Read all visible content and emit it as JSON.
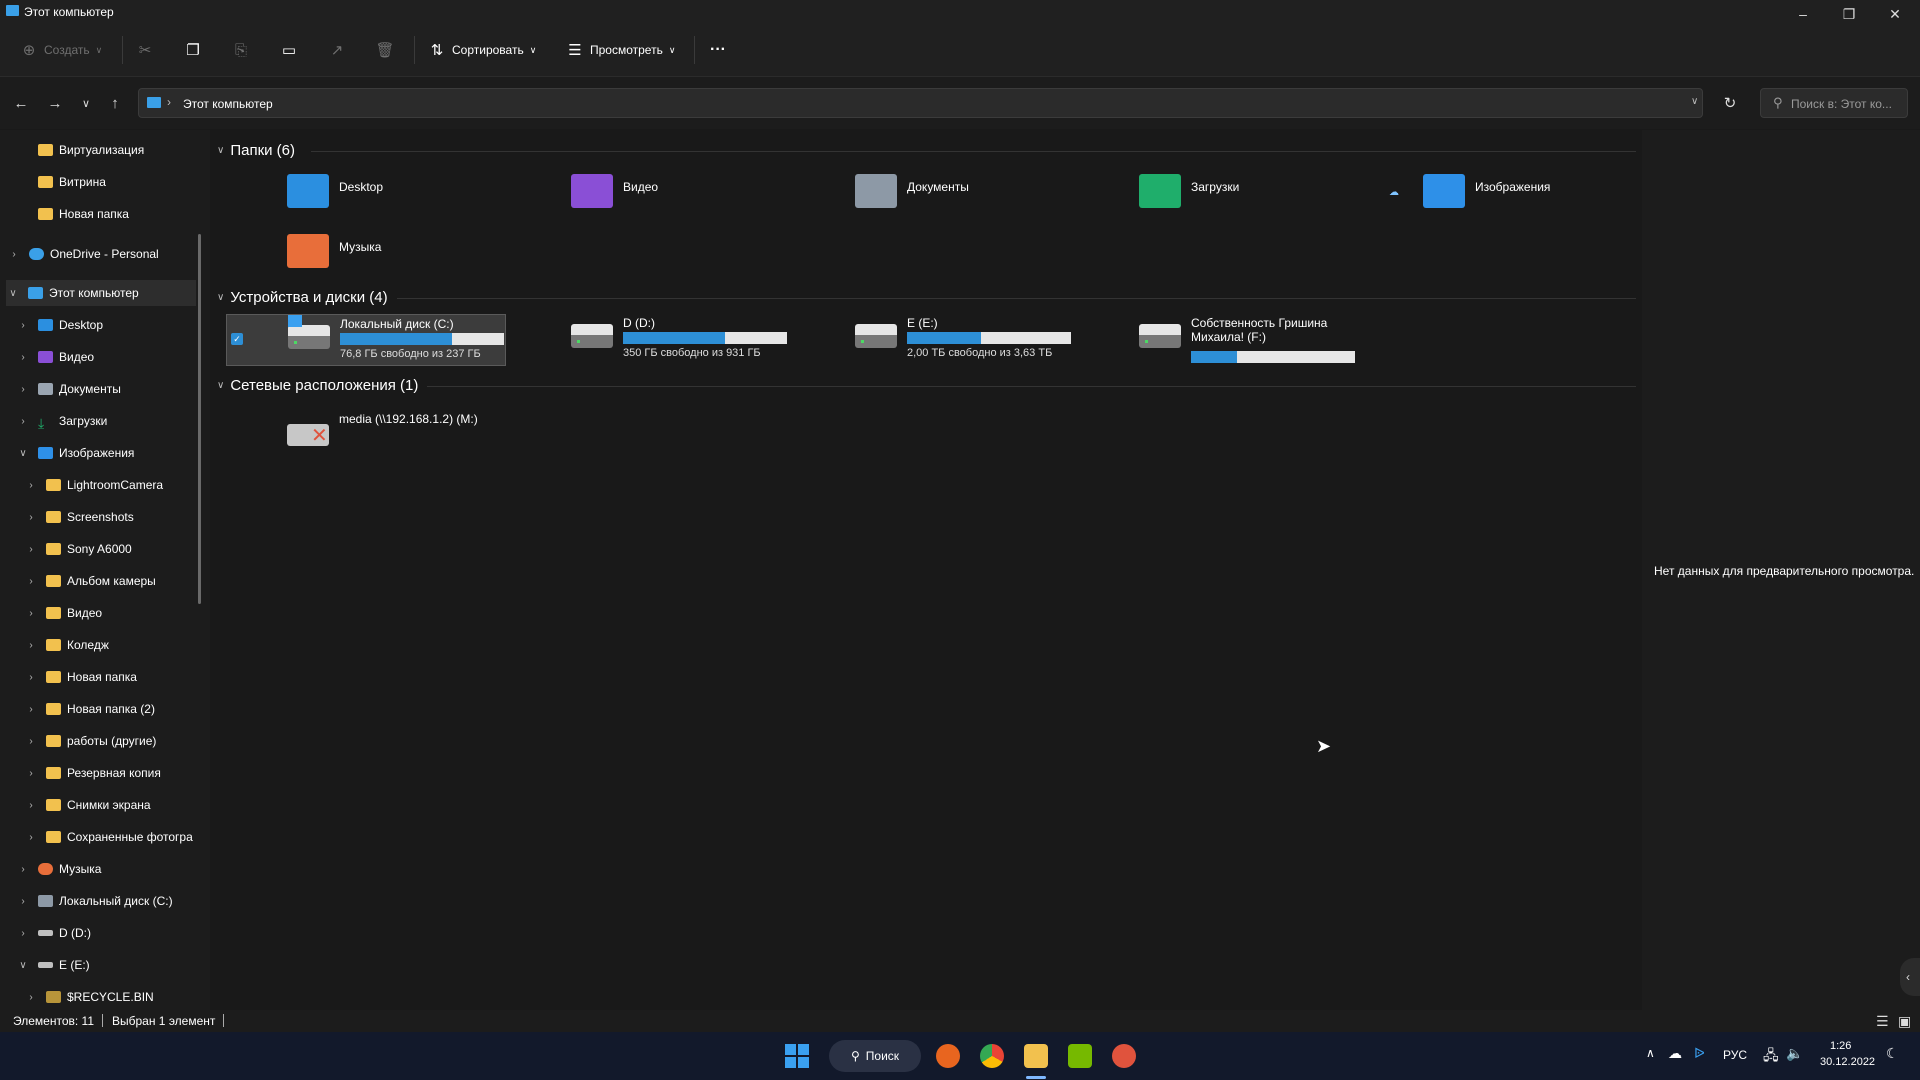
{
  "window": {
    "title": "Этот компьютер"
  },
  "toolbar": {
    "create": "Создать",
    "sort": "Сортировать",
    "view": "Просмотреть",
    "more": "···"
  },
  "address": {
    "path": "Этот компьютер",
    "search_placeholder": "Поиск в: Этот ко..."
  },
  "sidebar": {
    "quick": [
      "Виртуализация",
      "Витрина",
      "Новая папка"
    ],
    "onedrive": "OneDrive - Personal",
    "this_pc": "Этот компьютер",
    "pc_items": [
      "Desktop",
      "Видео",
      "Документы",
      "Загрузки",
      "Изображения"
    ],
    "images_children": [
      "LightroomCamera",
      "Screenshots",
      "Sony A6000",
      "Альбом камеры",
      "Видео",
      "Коледж",
      "Новая папка",
      "Новая папка (2)",
      "работы (другие)",
      "Резервная копия",
      "Снимки экрана",
      "Сохраненные фотогра"
    ],
    "after": [
      "Музыка",
      "Локальный диск (C:)",
      "D (D:)",
      "E (E:)"
    ],
    "recycle": "$RECYCLE.BIN"
  },
  "groups": {
    "folders": "Папки (6)",
    "devices": "Устройства и диски (4)",
    "network": "Сетевые расположения (1)"
  },
  "folders": [
    {
      "name": "Desktop",
      "color": "#2b8fe0"
    },
    {
      "name": "Видео",
      "color": "#8a4fd6"
    },
    {
      "name": "Документы",
      "color": "#8d99a6"
    },
    {
      "name": "Загрузки",
      "color": "#1fae6b"
    },
    {
      "name": "Изображения",
      "color": "#2e90e8"
    },
    {
      "name": "Музыка",
      "color": "#e86e3a"
    }
  ],
  "drives": [
    {
      "name": "Локальный диск (C:)",
      "free": "76,8 ГБ свободно из 237 ГБ",
      "used_fraction": 0.68
    },
    {
      "name": "D (D:)",
      "free": "350 ГБ свободно из 931 ГБ",
      "used_fraction": 0.62
    },
    {
      "name": "E (E:)",
      "free": "2,00 ТБ свободно из 3,63 ТБ",
      "used_fraction": 0.45
    },
    {
      "name": "Собственность Гришина Михаила! (F:)",
      "free": "",
      "used_fraction": 0.28
    }
  ],
  "network": [
    {
      "name": "media (\\\\192.168.1.2) (M:)"
    }
  ],
  "preview": {
    "text": "Нет данных для предварительного просмотра."
  },
  "status": {
    "count": "Элементов: 11",
    "selected": "Выбран 1 элемент"
  },
  "taskbar": {
    "search": "Поиск",
    "lang": "РУС",
    "time": "1:26",
    "date": "30.12.2022"
  }
}
